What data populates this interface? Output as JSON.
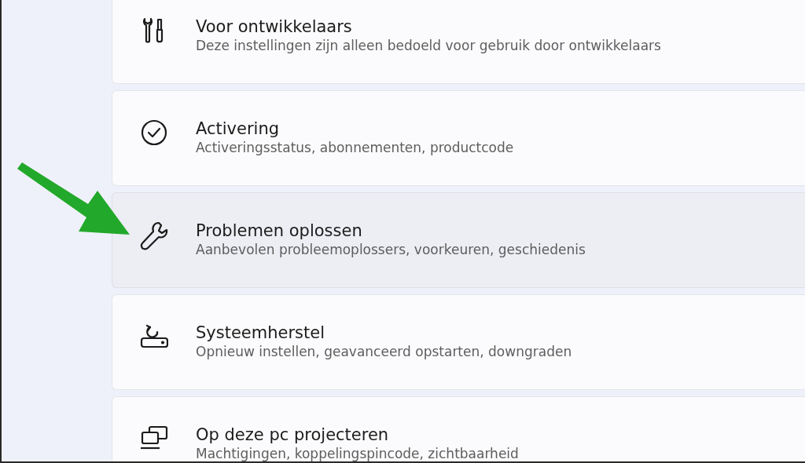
{
  "settings_items": [
    {
      "title": "Voor ontwikkelaars",
      "subtitle": "Deze instellingen zijn alleen bedoeld voor gebruik door ontwikkelaars",
      "selected": false
    },
    {
      "title": "Activering",
      "subtitle": "Activeringsstatus, abonnementen, productcode",
      "selected": false
    },
    {
      "title": "Problemen oplossen",
      "subtitle": "Aanbevolen probleemoplossers, voorkeuren, geschiedenis",
      "selected": true
    },
    {
      "title": "Systeemherstel",
      "subtitle": "Opnieuw instellen, geavanceerd opstarten, downgraden",
      "selected": false
    },
    {
      "title": "Op deze pc projecteren",
      "subtitle": "Machtigingen, koppelingspincode, zichtbaarheid",
      "selected": false
    }
  ]
}
